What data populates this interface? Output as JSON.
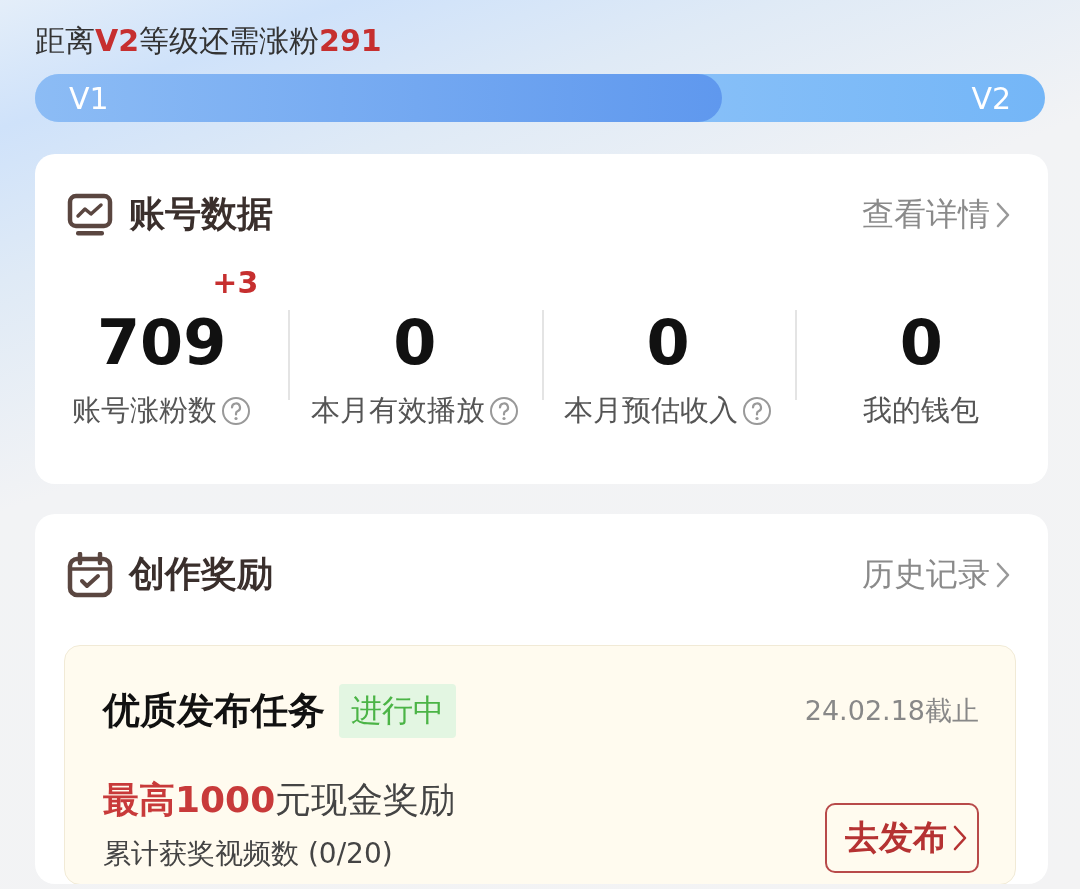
{
  "level_header": {
    "text": "距离**V2**等级还需涨粉**291**",
    "from_label": "V1",
    "to_label": "V2",
    "level": 0.68
  },
  "account_data": {
    "title": "账号数据",
    "link": "查看详情",
    "stats": [
      {
        "value": "709",
        "delta": "+3",
        "label": "账号涨粉数",
        "help": true
      },
      {
        "value": "0",
        "label": "本月有效播放",
        "help": true
      },
      {
        "value": "0",
        "label": "本月预估收入",
        "help": true
      },
      {
        "value": "0",
        "label": "我的钱包",
        "help": false
      }
    ]
  },
  "creation_rewards": {
    "title": "创作奖励",
    "link": "历史记录",
    "task": {
      "title": "优质发布任务",
      "status": "进行中",
      "deadline": "24.02.18截止",
      "reward": "**最高1000**元现金奖励",
      "progress": "累计获奖视频数 (0/20)",
      "button": "去发布"
    }
  }
}
